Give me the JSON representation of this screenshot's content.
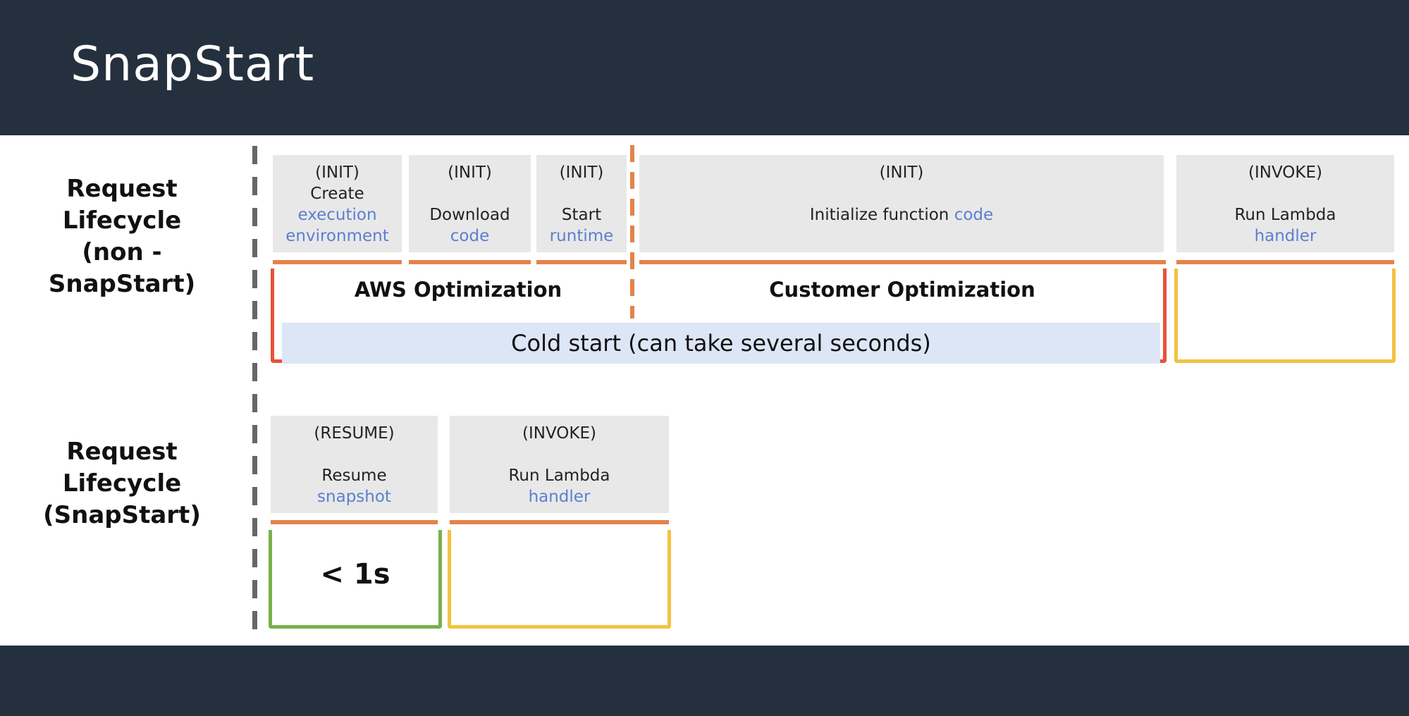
{
  "slide": {
    "title": "SnapStart"
  },
  "rows": {
    "non_snapstart": {
      "label_line1": "Request Lifecycle",
      "label_line2": "(non - SnapStart)"
    },
    "snapstart": {
      "label_line1": "Request Lifecycle",
      "label_line2": "(SnapStart)"
    }
  },
  "non_snapstart_steps": [
    {
      "stage": "(INIT)",
      "line1": "Create",
      "line2": "execution",
      "line3": "environment"
    },
    {
      "stage": "(INIT)",
      "line1": "Download",
      "line2": "code"
    },
    {
      "stage": "(INIT)",
      "line1": "Start",
      "line2": "runtime"
    },
    {
      "stage": "(INIT)",
      "line1": "Initialize function ",
      "line2": "code"
    },
    {
      "stage": "(INVOKE)",
      "line1": "Run Lambda",
      "line2": "handler"
    }
  ],
  "snapstart_steps": [
    {
      "stage": "(RESUME)",
      "line1": "Resume",
      "line2": "snapshot"
    },
    {
      "stage": "(INVOKE)",
      "line1": "Run Lambda",
      "line2": "handler"
    }
  ],
  "optimizations": {
    "aws": "AWS Optimization",
    "customer": "Customer Optimization",
    "cold_start": "Cold start (can take several seconds)",
    "snapstart_time": "< 1s"
  },
  "colors": {
    "header_bg": "#25303f",
    "orange_bar": "#e3834a",
    "cold_frame": "#e8523a",
    "invoke_frame": "#f2c342",
    "resume_frame": "#7ab04c",
    "link_blue": "#5b7fd1",
    "cold_fill": "#dde6f6"
  }
}
